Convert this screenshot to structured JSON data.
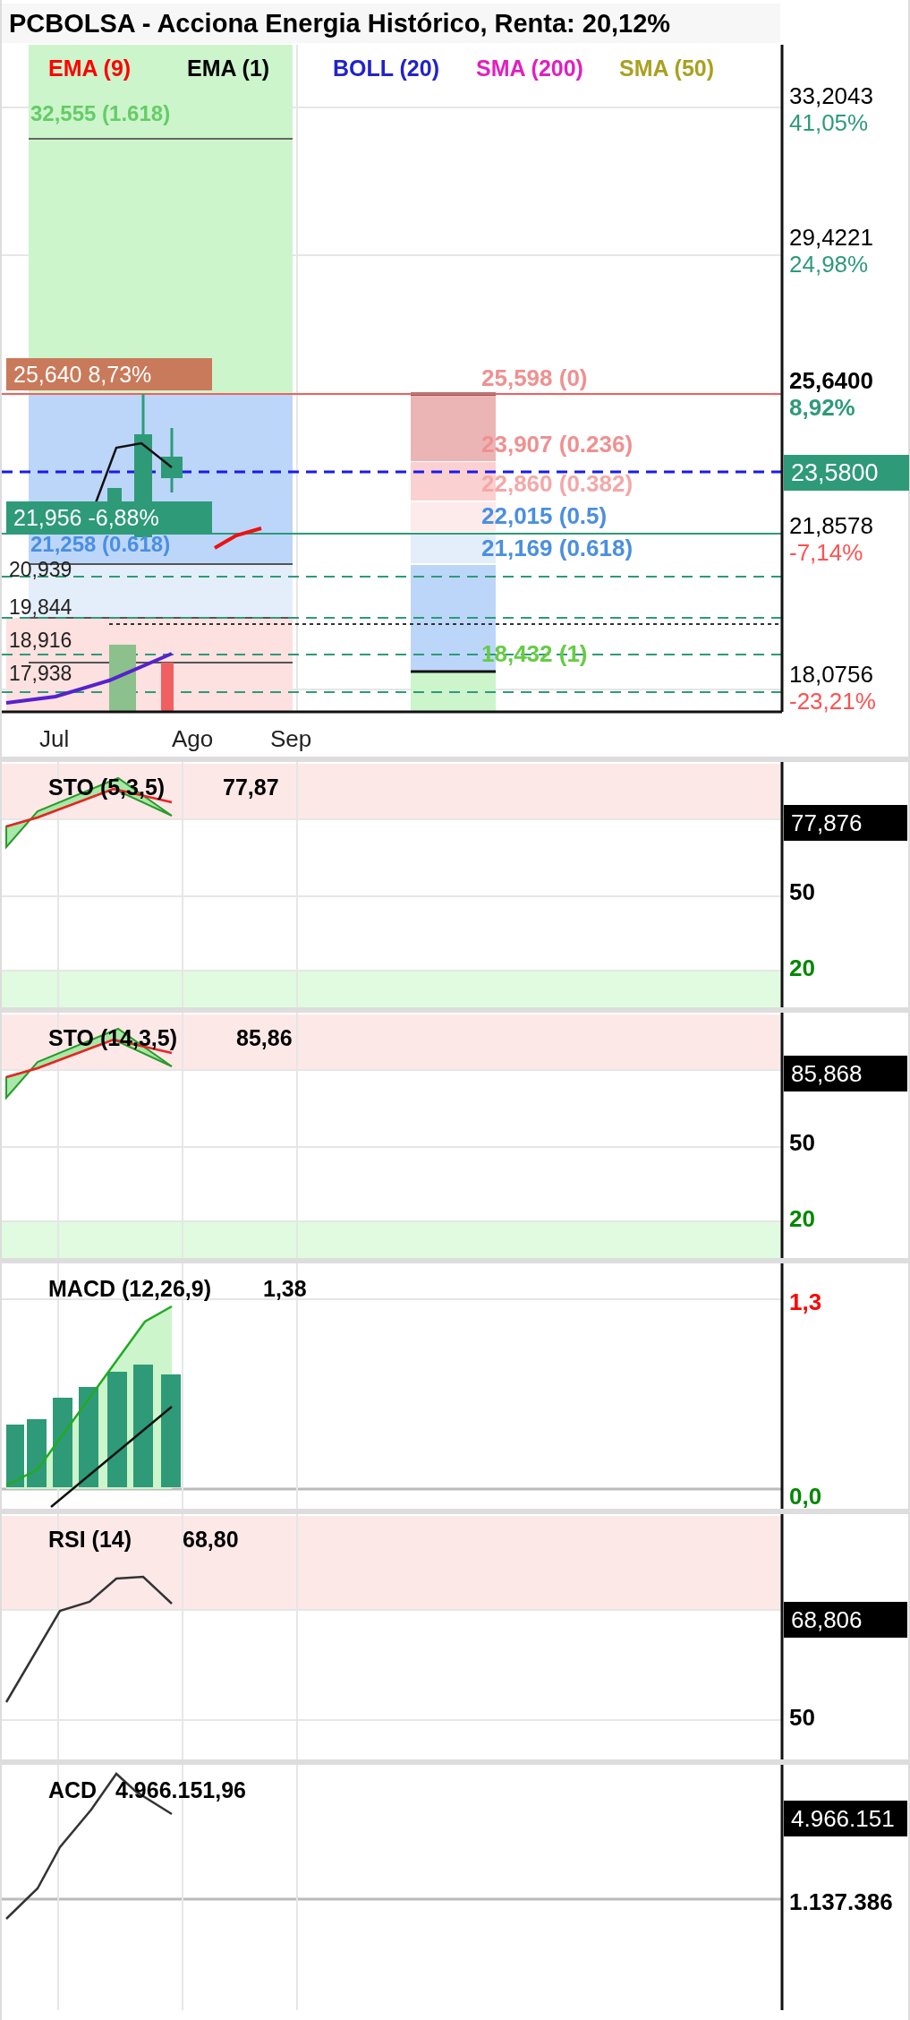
{
  "title": "PCBOLSA - Acciona Energia Histórico, Renta: 20,12%",
  "legend": [
    {
      "label": "EMA (9)",
      "color": "#ff0000"
    },
    {
      "label": "EMA (1)",
      "color": "#000000"
    },
    {
      "label": "BOLL (20)",
      "color": "#2222cc"
    },
    {
      "label": "SMA (200)",
      "color": "#e020c0"
    },
    {
      "label": "SMA (50)",
      "color": "#aaa020"
    }
  ],
  "fib_left": [
    {
      "text": "32,555 (1.618)",
      "color": "#66cc66"
    },
    {
      "text": "21,258 (0.618)",
      "color": "#4a8fe0"
    }
  ],
  "price_tags": [
    {
      "text": "25,640  8,73%",
      "color": "#c97a5a"
    },
    {
      "text": "21,956  -6,88%",
      "color": "#2e9a78"
    }
  ],
  "price_levels": [
    "20,939",
    "19,844",
    "18,916",
    "17,938"
  ],
  "fib_right": [
    {
      "text": "25,598 (0)",
      "color": "#f09090"
    },
    {
      "text": "23,907 (0.236)",
      "color": "#f09090"
    },
    {
      "text": "22,860 (0.382)",
      "color": "#f4a8a8"
    },
    {
      "text": "22,015 (0.5)",
      "color": "#4a8fe0"
    },
    {
      "text": "21,169 (0.618)",
      "color": "#4a8fe0"
    },
    {
      "text": "18,432 (1)",
      "color": "#66cc44"
    }
  ],
  "axis": [
    {
      "value": "33,2043",
      "change": "41,05%",
      "color": "#2e9a78",
      "emphasis": false
    },
    {
      "value": "29,4221",
      "change": "24,98%",
      "color": "#2e9a78",
      "emphasis": false
    },
    {
      "value": "25,6400",
      "change": "8,92%",
      "color": "#2e9a78",
      "emphasis": true
    },
    {
      "value": "21,8578",
      "change": "-7,14%",
      "color": "#ff5050",
      "emphasis": false
    },
    {
      "value": "18,0756",
      "change": "-23,21%",
      "color": "#ff5050",
      "emphasis": false
    }
  ],
  "current_price": "23,5800",
  "x_labels": [
    "Jul",
    "Ago",
    "Sep"
  ],
  "panels": [
    {
      "kind": "sto",
      "title": "STO (5,3,5)",
      "value": "77,87",
      "tag": "77,876",
      "axis_labels": [
        {
          "text": "50",
          "color": "#000000"
        },
        {
          "text": "20",
          "color": "#008800"
        }
      ]
    },
    {
      "kind": "sto",
      "title": "STO (14,3,5)",
      "value": "85,86",
      "tag": "85,868",
      "axis_labels": [
        {
          "text": "50",
          "color": "#000000"
        },
        {
          "text": "20",
          "color": "#008800"
        }
      ]
    },
    {
      "kind": "macd",
      "title": "MACD (12,26,9)",
      "value": "1,38",
      "axis_labels": [
        {
          "text": "1,3",
          "color": "#ff0000"
        },
        {
          "text": "0,0",
          "color": "#008800"
        }
      ]
    },
    {
      "kind": "rsi",
      "title": "RSI (14)",
      "value": "68,80",
      "tag": "68,806",
      "axis_labels": [
        {
          "text": "50",
          "color": "#000000"
        }
      ]
    },
    {
      "kind": "acd",
      "title": "ACD",
      "value": "4.966.151,96",
      "tag": "4.966.151",
      "axis_labels": [
        {
          "text": "1.137.386",
          "color": "#000000"
        }
      ]
    }
  ]
}
